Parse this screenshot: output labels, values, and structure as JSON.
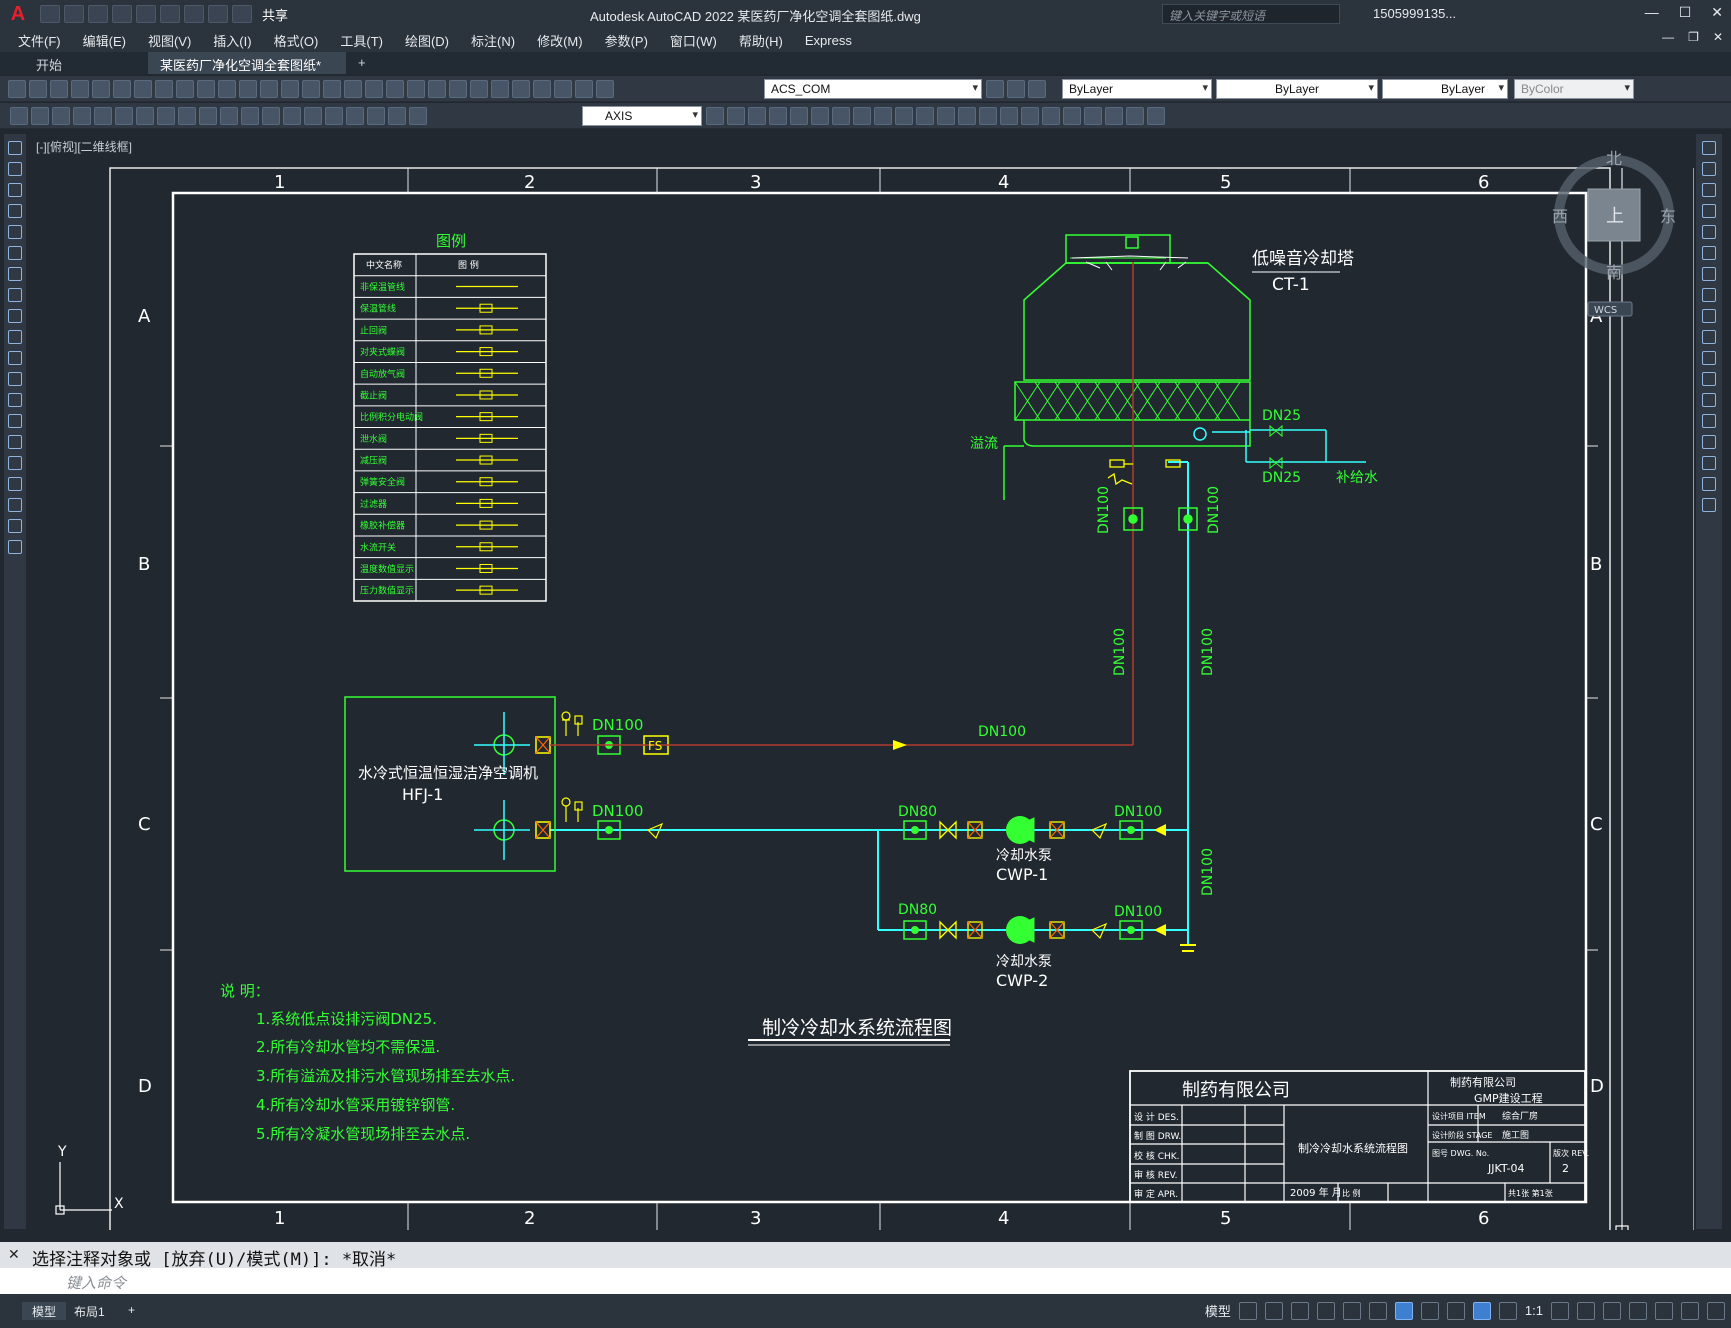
{
  "window": {
    "app_title": "Autodesk AutoCAD 2022    某医药厂净化空调全套图纸.dwg",
    "search_placeholder": "键入关键字或短语",
    "user": "1505999135...",
    "share": "共享",
    "logo_letter": "A"
  },
  "menu": [
    "文件(F)",
    "编辑(E)",
    "视图(V)",
    "插入(I)",
    "格式(O)",
    "工具(T)",
    "绘图(D)",
    "标注(N)",
    "修改(M)",
    "参数(P)",
    "窗口(W)",
    "帮助(H)",
    "Express"
  ],
  "tabs": [
    {
      "label": "开始"
    },
    {
      "label": "某医药厂净化空调全套图纸*"
    },
    {
      "label": "+"
    }
  ],
  "tab_close": "✕",
  "toolbar": {
    "layer": "ACS_COM",
    "color": "ByLayer",
    "linetype": "ByLayer",
    "lineweight": "ByLayer",
    "plotstyle": "ByColor",
    "textstyle": "AXIS"
  },
  "viewport_label": "[-][俯视][二维线框]",
  "viewcube": {
    "north": "北",
    "south": "南",
    "east": "东",
    "west": "西",
    "top": "上",
    "wcs": "WCS"
  },
  "drawing": {
    "col_labels": [
      "1",
      "2",
      "3",
      "4",
      "5",
      "6"
    ],
    "row_labels": [
      "A",
      "B",
      "C",
      "D"
    ],
    "legend_title": "图例",
    "legend_head": [
      "中文名称",
      "图 例"
    ],
    "legend_items": [
      "非保温管线",
      "保温管线",
      "止回阀",
      "对夹式蝶阀",
      "自动放气阀",
      "截止阀",
      "比例积分电动阀",
      "泄水阀",
      "减压阀",
      "弹簧安全阀",
      "过滤器",
      "橡胶补偿器",
      "水流开关",
      "温度数值显示",
      "压力数值显示"
    ],
    "cooling_tower_name": "低噪音冷却塔",
    "cooling_tower_code": "CT-1",
    "overflow": "溢流",
    "makeup": "补给水",
    "dn25": "DN25",
    "dn100": "DN100",
    "dn80": "DN80",
    "ahu_name": "水冷式恒温恒湿洁净空调机",
    "ahu_code": "HFJ-1",
    "fs": "FS",
    "pump_name": "冷却水泵",
    "pump1": "CWP-1",
    "pump2": "CWP-2",
    "diagram_title": "制冷冷却水系统流程图",
    "notes_title": "说 明：",
    "notes": [
      "1.系统低点设排污阀DN25.",
      "2.所有冷却水管均不需保温.",
      "3.所有溢流及排污水管现场排至去水点.",
      "4.所有冷却水管采用镀锌钢管.",
      "5.所有冷凝水管现场排至去水点."
    ],
    "ucs_y": "Y",
    "ucs_x": "X",
    "titleblock": {
      "company": "制药有限公司",
      "client": "制药有限公司",
      "project_line": "GMP建设工程",
      "roles": [
        "设 计 DES.",
        "制 图 DRW.",
        "校 核 CHK.",
        "审 核 REV.",
        "审 定 APR."
      ],
      "drawing_title": "制冷冷却水系统流程图",
      "item_label": "设计项目 ITEM",
      "item_value": "综合厂房",
      "stage_label": "设计阶段 STAGE",
      "stage_value": "施工图",
      "dwg_label": "图号 DWG. No.",
      "dwg_value": "JJKT-04",
      "rev_label": "版次 REV.",
      "rev_value": "2",
      "date": "2009 年 月",
      "scale_label": "比 例",
      "sheet": "共1张 第1张"
    }
  },
  "command": {
    "history": "选择注释对象或 [放弃(U)/模式(M)]: *取消*",
    "placeholder": "键入命令"
  },
  "status": {
    "layouts": [
      "模型",
      "布局1",
      "+"
    ],
    "model": "模型",
    "scale": "1:1"
  }
}
